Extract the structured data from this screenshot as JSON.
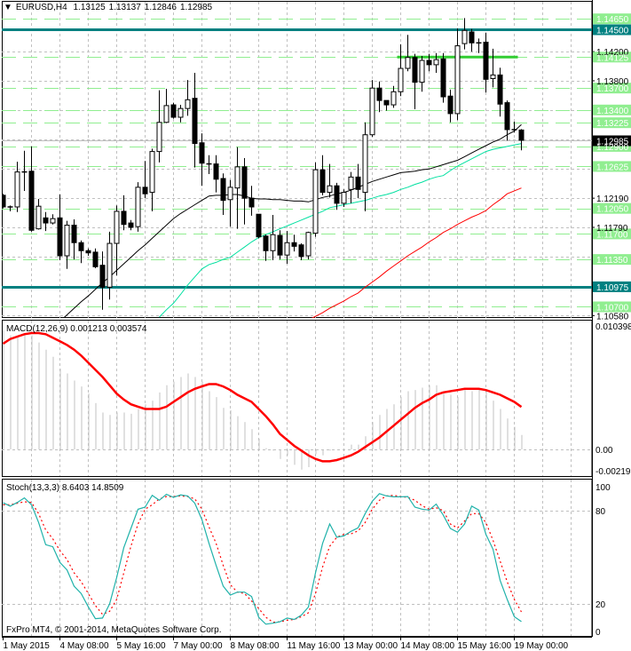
{
  "header": {
    "menu_icon": "triangle-down-icon",
    "symbol": "EURUSD,H4",
    "open": "1.13125",
    "high": "1.13137",
    "low": "1.12846",
    "close": "1.12985"
  },
  "colors": {
    "candle_bull": "#ffffff",
    "candle_bear": "#000000",
    "ma_black": "#000000",
    "ma_teal": "#00e0a0",
    "ma_red": "#ff0000",
    "level_line": "#90ee90",
    "key_level": "#008080",
    "trend_segment": "#32cd32",
    "grid": "#c0c0c0",
    "macd_hist": "#c0c0c0",
    "macd_signal": "#ff0000",
    "stoch_main": "#20b2aa",
    "stoch_signal": "#ff0000"
  },
  "footer": {
    "copyright": "FxPro MT4, © 2001-2014, MetaQuotes Software Corp."
  },
  "chart_data": [
    {
      "type": "candlestick",
      "symbol": "EURUSD",
      "timeframe": "H4",
      "ylim": [
        1.1058,
        1.1466
      ],
      "grid": true,
      "price_axis_labels": [
        "1.14200",
        "1.13800",
        "1.12190",
        "1.11790",
        "1.10580"
      ],
      "current_price": "1.12985",
      "levels": [
        {
          "price": 1.1465,
          "label": "1.14650",
          "style": "dashed"
        },
        {
          "price": 1.14125,
          "label": "1.14125",
          "style": "dashed"
        },
        {
          "price": 1.137,
          "label": "1.13700",
          "style": "dashed"
        },
        {
          "price": 1.134,
          "label": "1.13400",
          "style": "dashed"
        },
        {
          "price": 1.13225,
          "label": "1.13225",
          "style": "dashed"
        },
        {
          "price": 1.129,
          "label": "1.12900",
          "style": "dashed"
        },
        {
          "price": 1.12625,
          "label": "1.12625",
          "style": "dashed"
        },
        {
          "price": 1.1205,
          "label": "1.12050",
          "style": "dashed"
        },
        {
          "price": 1.117,
          "label": "1.11700",
          "style": "dashed"
        },
        {
          "price": 1.1135,
          "label": "1.11350",
          "style": "dashed"
        },
        {
          "price": 1.107,
          "label": "1.10700",
          "style": "dashed"
        },
        {
          "price": 1.145,
          "label": "1.14500",
          "style": "key"
        },
        {
          "price": 1.10975,
          "label": "1.10975",
          "style": "key"
        }
      ],
      "trend_segment": {
        "price": 1.14125,
        "from_bar": 56,
        "to_bar": 72
      },
      "time_labels": [
        "1 May 2015",
        "4 May 08:00",
        "5 May 16:00",
        "7 May 00:00",
        "8 May 08:00",
        "11 May 16:00",
        "13 May 00:00",
        "14 May 08:00",
        "15 May 16:00",
        "19 May 00:00"
      ],
      "ohlc": [
        [
          1.1223,
          1.1225,
          1.1205,
          1.1207
        ],
        [
          1.1207,
          1.1209,
          1.1201,
          1.1207
        ],
        [
          1.1207,
          1.1269,
          1.12,
          1.1255
        ],
        [
          1.1255,
          1.1284,
          1.1229,
          1.1254
        ],
        [
          1.1256,
          1.129,
          1.1173,
          1.1175
        ],
        [
          1.1177,
          1.1218,
          1.1176,
          1.1208
        ],
        [
          1.1192,
          1.12,
          1.1174,
          1.1185
        ],
        [
          1.1185,
          1.1197,
          1.1183,
          1.1191
        ],
        [
          1.1192,
          1.1224,
          1.1134,
          1.114
        ],
        [
          1.114,
          1.1188,
          1.1122,
          1.1182
        ],
        [
          1.1182,
          1.119,
          1.1135,
          1.1158
        ],
        [
          1.1158,
          1.1161,
          1.113,
          1.1147
        ],
        [
          1.1147,
          1.115,
          1.114,
          1.1144
        ],
        [
          1.1145,
          1.115,
          1.1123,
          1.1125
        ],
        [
          1.1127,
          1.1146,
          1.1066,
          1.1097
        ],
        [
          1.1097,
          1.1173,
          1.108,
          1.1157
        ],
        [
          1.1157,
          1.1209,
          1.1113,
          1.1201
        ],
        [
          1.1201,
          1.1223,
          1.1175,
          1.1183
        ],
        [
          1.1185,
          1.1189,
          1.1175,
          1.1179
        ],
        [
          1.118,
          1.1241,
          1.1173,
          1.1234
        ],
        [
          1.1234,
          1.127,
          1.1219,
          1.1225
        ],
        [
          1.1227,
          1.1287,
          1.1201,
          1.1283
        ],
        [
          1.1283,
          1.1367,
          1.1268,
          1.1323
        ],
        [
          1.1323,
          1.1369,
          1.1322,
          1.1346
        ],
        [
          1.1347,
          1.135,
          1.1328,
          1.133
        ],
        [
          1.133,
          1.1347,
          1.1323,
          1.1342
        ],
        [
          1.1342,
          1.1381,
          1.1332,
          1.1354
        ],
        [
          1.1356,
          1.1391,
          1.1261,
          1.1294
        ],
        [
          1.1295,
          1.1308,
          1.1236,
          1.1267
        ],
        [
          1.1266,
          1.1278,
          1.1252,
          1.1265
        ],
        [
          1.1266,
          1.1278,
          1.1227,
          1.1245
        ],
        [
          1.1246,
          1.1253,
          1.1196,
          1.1216
        ],
        [
          1.1217,
          1.1244,
          1.118,
          1.1234
        ],
        [
          1.1233,
          1.1289,
          1.1177,
          1.1262
        ],
        [
          1.1262,
          1.1274,
          1.1183,
          1.1219
        ],
        [
          1.1219,
          1.1236,
          1.1195,
          1.1207
        ],
        [
          1.1197,
          1.1197,
          1.1164,
          1.1166
        ],
        [
          1.1167,
          1.1169,
          1.1133,
          1.1147
        ],
        [
          1.1147,
          1.1196,
          1.1134,
          1.1169
        ],
        [
          1.1168,
          1.1175,
          1.1135,
          1.1141
        ],
        [
          1.1141,
          1.1174,
          1.1129,
          1.1158
        ],
        [
          1.1158,
          1.1169,
          1.1146,
          1.1153
        ],
        [
          1.1155,
          1.1157,
          1.1134,
          1.1139
        ],
        [
          1.114,
          1.1173,
          1.1135,
          1.1172
        ],
        [
          1.1171,
          1.1268,
          1.1166,
          1.1258
        ],
        [
          1.1258,
          1.1278,
          1.1223,
          1.1227
        ],
        [
          1.1227,
          1.1266,
          1.122,
          1.1236
        ],
        [
          1.1236,
          1.124,
          1.1203,
          1.1212
        ],
        [
          1.1212,
          1.1231,
          1.1207,
          1.1227
        ],
        [
          1.1231,
          1.1255,
          1.1212,
          1.1248
        ],
        [
          1.1248,
          1.1266,
          1.1219,
          1.1231
        ],
        [
          1.1227,
          1.1323,
          1.1201,
          1.1306
        ],
        [
          1.1306,
          1.1381,
          1.1303,
          1.137
        ],
        [
          1.137,
          1.1379,
          1.1337,
          1.1353
        ],
        [
          1.1353,
          1.1353,
          1.1339,
          1.1347
        ],
        [
          1.1347,
          1.1373,
          1.1343,
          1.1365
        ],
        [
          1.1365,
          1.143,
          1.1359,
          1.1397
        ],
        [
          1.1397,
          1.1443,
          1.1393,
          1.1412
        ],
        [
          1.1412,
          1.1417,
          1.1341,
          1.1378
        ],
        [
          1.1378,
          1.1414,
          1.1365,
          1.1408
        ],
        [
          1.1408,
          1.1417,
          1.1393,
          1.1402
        ],
        [
          1.1402,
          1.1418,
          1.1391,
          1.1409
        ],
        [
          1.141,
          1.1418,
          1.135,
          1.1358
        ],
        [
          1.1359,
          1.1368,
          1.1323,
          1.1335
        ],
        [
          1.1335,
          1.1452,
          1.1326,
          1.1428
        ],
        [
          1.1431,
          1.1466,
          1.1423,
          1.1449
        ],
        [
          1.1447,
          1.1451,
          1.142,
          1.1432
        ],
        [
          1.1432,
          1.1438,
          1.1418,
          1.1431
        ],
        [
          1.1433,
          1.1446,
          1.1364,
          1.1382
        ],
        [
          1.1383,
          1.1424,
          1.1371,
          1.1388
        ],
        [
          1.1388,
          1.1398,
          1.1331,
          1.1348
        ],
        [
          1.135,
          1.1353,
          1.1298,
          1.1313
        ],
        [
          1.1313,
          1.1324,
          1.1309,
          1.1312
        ],
        [
          1.13125,
          1.13137,
          1.12846,
          1.12985
        ]
      ],
      "moving_averages": [
        {
          "color": "#000000",
          "values": [
            null,
            null,
            null,
            null,
            null,
            null,
            null,
            null,
            1.105,
            1.1059,
            1.1068,
            1.1077,
            1.1085,
            1.1094,
            1.1103,
            1.1111,
            1.112,
            1.1129,
            1.1138,
            1.1147,
            1.1155,
            1.1164,
            1.1173,
            1.1182,
            1.1191,
            1.1198,
            1.1204,
            1.121,
            1.1216,
            1.1222,
            1.1223,
            1.1223,
            1.1224,
            1.1224,
            1.1222,
            1.1219,
            1.1218,
            1.1218,
            1.1217,
            1.1217,
            1.1216,
            1.1215,
            1.1215,
            1.1214,
            1.1217,
            1.122,
            1.1222,
            1.1225,
            1.1227,
            1.123,
            1.1234,
            1.1238,
            1.1242,
            1.1245,
            1.1248,
            1.1251,
            1.1254,
            1.1255,
            1.1256,
            1.1258,
            1.1259,
            1.1262,
            1.1265,
            1.1268,
            1.1271,
            1.1276,
            1.1281,
            1.1286,
            1.1291,
            1.1296,
            1.13,
            1.1306,
            1.1311,
            1.132
          ]
        },
        {
          "color": "#00e0a0",
          "values": [
            null,
            null,
            null,
            null,
            null,
            null,
            null,
            null,
            null,
            null,
            null,
            null,
            null,
            null,
            null,
            null,
            null,
            null,
            null,
            null,
            null,
            null,
            1.1056,
            1.1066,
            1.1075,
            1.1087,
            1.11,
            1.1111,
            1.1122,
            1.1128,
            1.1131,
            1.1135,
            1.1138,
            1.1145,
            1.1152,
            1.1159,
            1.1165,
            1.1169,
            1.1173,
            1.1177,
            1.1181,
            1.1185,
            1.1189,
            1.1193,
            1.1197,
            1.1201,
            1.1206,
            1.1208,
            1.121,
            1.1212,
            1.1214,
            1.1216,
            1.1219,
            1.1222,
            1.1224,
            1.1227,
            1.1231,
            1.1234,
            1.1238,
            1.1241,
            1.1245,
            1.1248,
            1.125,
            1.1257,
            1.1263,
            1.1268,
            1.1273,
            1.1278,
            1.1283,
            1.1286,
            1.1288,
            1.129,
            1.1292,
            1.1294
          ]
        },
        {
          "color": "#ff0000",
          "values": [
            null,
            null,
            null,
            null,
            null,
            null,
            null,
            null,
            null,
            null,
            null,
            null,
            null,
            null,
            null,
            null,
            null,
            null,
            null,
            null,
            null,
            null,
            null,
            null,
            null,
            null,
            null,
            null,
            null,
            null,
            null,
            null,
            null,
            null,
            null,
            null,
            null,
            null,
            null,
            null,
            null,
            null,
            null,
            1.1052,
            1.1057,
            1.1062,
            1.1068,
            1.1073,
            1.1078,
            1.1084,
            1.1089,
            1.1097,
            1.1104,
            1.1111,
            1.1119,
            1.1126,
            1.1133,
            1.114,
            1.1146,
            1.1152,
            1.1159,
            1.1165,
            1.1172,
            1.1177,
            1.1183,
            1.1188,
            1.1193,
            1.1197,
            1.1202,
            1.121,
            1.1217,
            1.1225,
            1.1229,
            1.1233
          ]
        }
      ]
    },
    {
      "type": "bar",
      "title": "MACD(12,26,9) 0.001213 0.003574",
      "axis_labels": {
        "max": "0.010398",
        "zero": "0.00",
        "min": "-0.002199"
      },
      "ylim": [
        -0.002199,
        0.010398
      ],
      "histogram": [
        0.01,
        0.0096,
        0.0095,
        0.0097,
        0.0096,
        0.009,
        0.0084,
        0.0078,
        0.0068,
        0.0064,
        0.0058,
        0.0053,
        0.0047,
        0.0039,
        0.0031,
        0.0029,
        0.0031,
        0.0031,
        0.003,
        0.0034,
        0.0038,
        0.0041,
        0.0048,
        0.0054,
        0.0057,
        0.0061,
        0.0064,
        0.0061,
        0.0057,
        0.0049,
        0.0044,
        0.0035,
        0.0033,
        0.0028,
        0.0023,
        0.0017,
        0.0009,
        0.0001,
        -0.0001,
        -0.0008,
        -0.0005,
        -0.0013,
        -0.0017,
        -0.0015,
        -0.0004,
        -0.0005,
        -0.0001,
        0.0,
        0.0,
        0.0004,
        0.0004,
        0.0011,
        0.0023,
        0.0029,
        0.0034,
        0.0038,
        0.0044,
        0.0049,
        0.005,
        0.0052,
        0.0054,
        0.0054,
        0.0047,
        0.0046,
        0.0044,
        0.0051,
        0.0049,
        0.0051,
        0.0049,
        0.0041,
        0.0034,
        0.0026,
        0.0019,
        0.001213
      ],
      "signal": [
        0.0089,
        0.0093,
        0.0095,
        0.0097,
        0.0098,
        0.0098,
        0.0097,
        0.0094,
        0.0091,
        0.0088,
        0.0084,
        0.0079,
        0.0073,
        0.0067,
        0.0061,
        0.0054,
        0.0047,
        0.0042,
        0.0038,
        0.0036,
        0.0034,
        0.0034,
        0.0034,
        0.0036,
        0.004,
        0.0044,
        0.0048,
        0.0051,
        0.0053,
        0.0055,
        0.0055,
        0.0053,
        0.005,
        0.0046,
        0.0043,
        0.004,
        0.0034,
        0.0028,
        0.0021,
        0.0013,
        0.0008,
        0.0003,
        -0.0001,
        -0.0005,
        -0.0008,
        -0.001,
        -0.001,
        -0.0009,
        -0.0007,
        -0.0005,
        -0.0002,
        0.0002,
        0.0006,
        0.001,
        0.0015,
        0.002,
        0.0025,
        0.003,
        0.0035,
        0.0039,
        0.0042,
        0.0046,
        0.0048,
        0.0049,
        0.005,
        0.0051,
        0.0051,
        0.0051,
        0.005,
        0.0048,
        0.0046,
        0.0043,
        0.004,
        0.003574
      ]
    },
    {
      "type": "line",
      "title": "Stoch(13,3,3) 8.6403 14.8509",
      "axis_labels": [
        "100",
        "80",
        "20",
        "0"
      ],
      "ylim": [
        0,
        100
      ],
      "levels": [
        80,
        20
      ],
      "main": [
        85.1,
        82.9,
        85.3,
        88.2,
        83.8,
        72.4,
        58.1,
        56.8,
        46.7,
        41.9,
        31.4,
        26.7,
        18.1,
        10.5,
        10.9,
        20.0,
        37.1,
        56.2,
        68.6,
        80.9,
        82.3,
        89.9,
        86.7,
        90.5,
        88.6,
        90.1,
        89.5,
        84.8,
        74.3,
        59.0,
        44.8,
        31.4,
        25.7,
        27.6,
        27.6,
        24.8,
        11.4,
        7.0,
        7.6,
        8.6,
        10.9,
        10.0,
        12.8,
        18.0,
        40.0,
        59.0,
        71.4,
        62.9,
        63.8,
        66.7,
        69.0,
        78.1,
        86.1,
        91.0,
        89.5,
        88.9,
        88.9,
        89.1,
        82.3,
        81.0,
        80.4,
        84.2,
        77.1,
        68.6,
        66.1,
        71.4,
        82.9,
        80.4,
        64.8,
        55.2,
        35.2,
        22.9,
        11.8,
        8.6403
      ],
      "signal": [
        83.8,
        83.8,
        84.8,
        85.7,
        85.3,
        78.1,
        67.6,
        61.9,
        54.3,
        48.6,
        40.0,
        34.3,
        26.7,
        19.0,
        13.3,
        15.2,
        22.9,
        40.0,
        57.1,
        71.4,
        81.0,
        83.8,
        87.6,
        89.1,
        89.1,
        89.5,
        89.1,
        87.6,
        81.0,
        69.5,
        59.0,
        44.8,
        32.4,
        27.6,
        26.7,
        21.9,
        17.1,
        11.4,
        8.2,
        8.6,
        9.5,
        10.0,
        11.8,
        14.3,
        26.7,
        43.8,
        57.1,
        62.9,
        64.8,
        65.1,
        67.0,
        72.4,
        81.0,
        86.7,
        89.5,
        89.9,
        89.1,
        88.6,
        86.7,
        83.2,
        81.0,
        81.9,
        80.0,
        71.4,
        68.9,
        73.3,
        78.1,
        78.1,
        72.4,
        61.0,
        47.6,
        34.3,
        22.9,
        14.8509
      ]
    }
  ]
}
